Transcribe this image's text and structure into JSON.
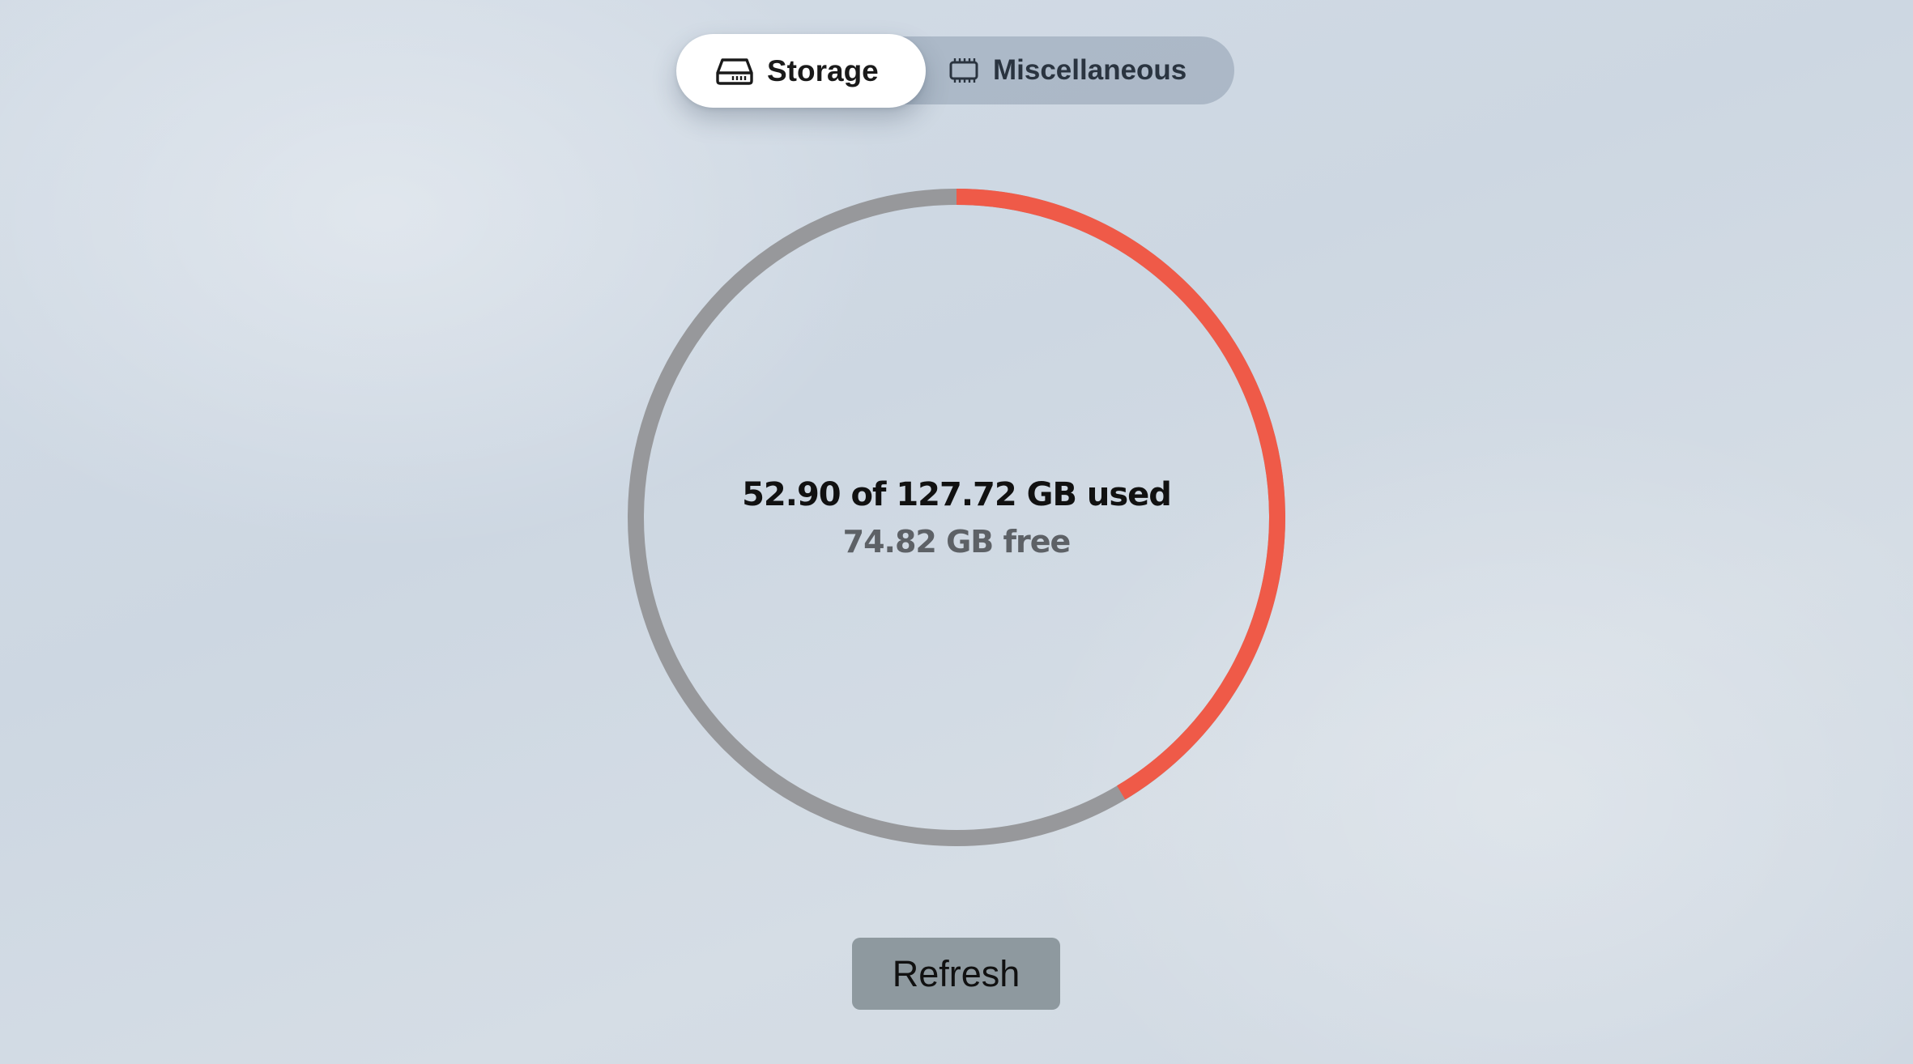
{
  "tabs": {
    "storage": {
      "label": "Storage",
      "icon": "hard-drive-icon",
      "selected": true
    },
    "miscellaneous": {
      "label": "Miscellaneous",
      "icon": "memory-chip-icon",
      "selected": false
    }
  },
  "storage": {
    "used_gb": 52.9,
    "total_gb": 127.72,
    "free_gb": 74.82,
    "used_fraction": 0.4142,
    "used_text": "52.90 of 127.72 GB used",
    "free_text": "74.82 GB free"
  },
  "colors": {
    "used": "#ef5a48",
    "free": "#97989b",
    "tab_selected_bg": "#ffffff",
    "button_bg": "#8e999f"
  },
  "actions": {
    "refresh_label": "Refresh"
  }
}
